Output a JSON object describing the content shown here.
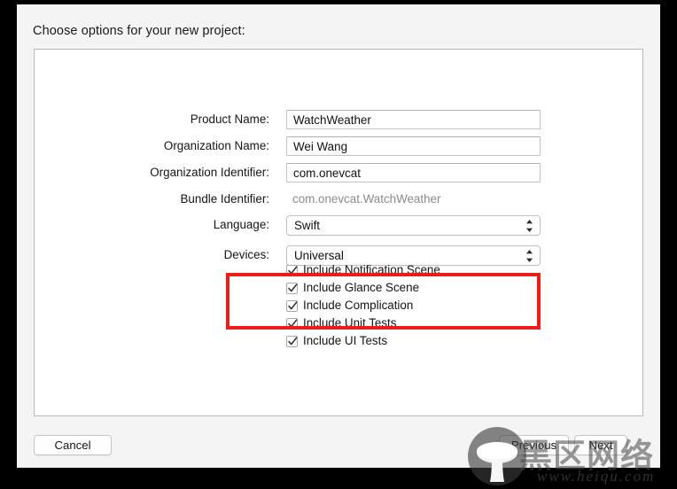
{
  "window": {
    "sheet_title": "Choose options for your new project:"
  },
  "form": {
    "rows": [
      {
        "label": "Product Name:",
        "type": "text",
        "value": "WatchWeather",
        "placeholder": ""
      },
      {
        "label": "Organization Name:",
        "type": "text",
        "value": "Wei Wang",
        "placeholder": ""
      },
      {
        "label": "Organization Identifier:",
        "type": "text",
        "value": "com.onevcat",
        "placeholder": ""
      },
      {
        "label": "Bundle Identifier:",
        "type": "static",
        "value": "com.onevcat.WatchWeather",
        "placeholder": ""
      },
      {
        "label": "Language:",
        "type": "select",
        "value": "Swift",
        "placeholder": ""
      },
      {
        "label": "Devices:",
        "type": "select",
        "value": "Universal",
        "placeholder": ""
      }
    ]
  },
  "options": {
    "checkboxes": [
      {
        "label": "Include Notification Scene",
        "checked": true
      },
      {
        "label": "Include Glance Scene",
        "checked": true
      },
      {
        "label": "Include Complication",
        "checked": true
      },
      {
        "label": "Include Unit Tests",
        "checked": true
      },
      {
        "label": "Include UI Tests",
        "checked": true
      }
    ]
  },
  "annotation": {
    "color": "#ee1c18",
    "encloses": [
      "Include Notification Scene",
      "Include Glance Scene",
      "Include Complication"
    ]
  },
  "footer": {
    "cancel_label": "Cancel",
    "previous_label": "Previous",
    "next_label": "Next"
  },
  "watermark": {
    "site_name": "黑区网络",
    "url": "www.heiqu.com"
  }
}
